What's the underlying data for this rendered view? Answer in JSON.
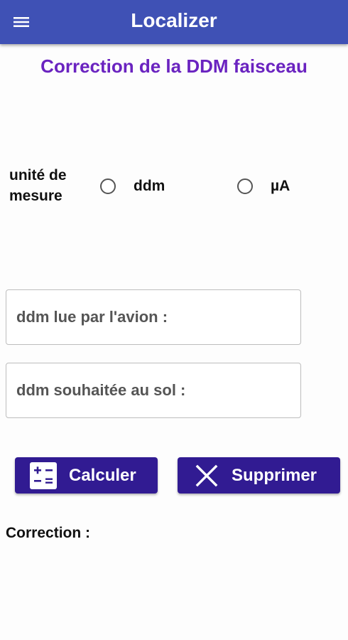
{
  "appbar": {
    "title": "Localizer",
    "menu_icon": "hamburger-menu-icon"
  },
  "page": {
    "title": "Correction de la DDM faisceau"
  },
  "unit": {
    "label_line1": "unité de",
    "label_line2": "mesure",
    "options": [
      {
        "label": "ddm",
        "selected": false
      },
      {
        "label": "µA",
        "selected": false
      }
    ]
  },
  "inputs": {
    "ddm_read": {
      "placeholder": "ddm lue par l'avion :",
      "value": ""
    },
    "ddm_wanted": {
      "placeholder": "ddm souhaitée au sol :",
      "value": ""
    }
  },
  "buttons": {
    "calculate": {
      "label": "Calculer",
      "icon": "calculator-icon"
    },
    "delete": {
      "label": "Supprimer",
      "icon": "close-icon"
    }
  },
  "result": {
    "label": "Correction :"
  },
  "colors": {
    "appbar": "#3f51b5",
    "title": "#6a23c0",
    "button": "#311b92"
  }
}
